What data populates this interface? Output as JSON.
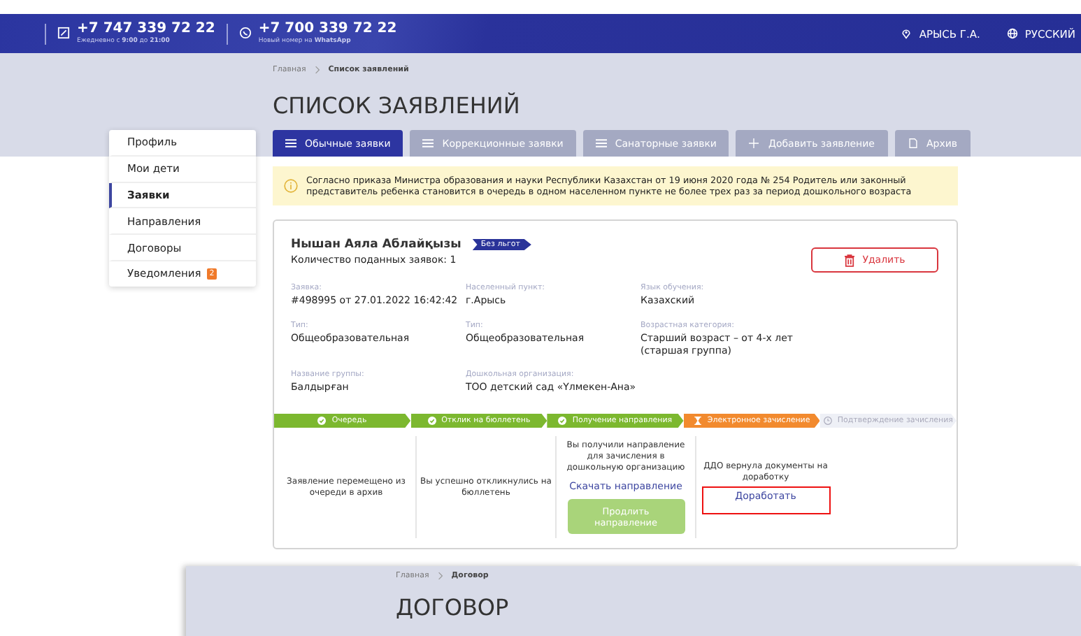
{
  "header": {
    "phone": "+7 747 339 72 22",
    "phone_hours": "Ежедневно с **9:00** до **21:00**",
    "whatsapp": "+7 700 339 72 22",
    "whatsapp_note": "Новый номер на **WhatsApp**",
    "location": "АРЫСЬ Г.А.",
    "language": "РУССКИЙ"
  },
  "breadcrumb": [
    "Главная",
    "Список заявлений"
  ],
  "title": "СПИСОК ЗАЯВЛЕНИЙ",
  "sidebar": [
    {
      "label": "Профиль",
      "selected": false
    },
    {
      "label": "Мои дети",
      "selected": false
    },
    {
      "label": "Заявки",
      "selected": true
    },
    {
      "label": "Направления",
      "selected": false
    },
    {
      "label": "Договоры",
      "selected": false
    },
    {
      "label": "Уведомления",
      "selected": false,
      "badge": "2"
    }
  ],
  "tabs": [
    {
      "label": "Обычные заявки",
      "selected": true,
      "kind": "list"
    },
    {
      "label": "Коррекционные заявки",
      "selected": false,
      "kind": "list"
    },
    {
      "label": "Санаторные заявки",
      "selected": false,
      "kind": "list"
    },
    {
      "label": "Добавить заявление",
      "selected": false,
      "kind": "add"
    },
    {
      "label": "Архив",
      "selected": false,
      "kind": "file"
    }
  ],
  "notice": "Согласно приказа Министра образования и науки Республики Казахстан от 19 июня 2020 года № 254 Родитель или законный представитель ребенка становится в очередь в одном населенном пункте не более трех раз за период дошкольного возраста",
  "application": {
    "name": "Нышан Аяла Аблайқызы",
    "tag": "Без льгот",
    "count": "Количество поданных заявок: 1",
    "delete": "Удалить",
    "fields": [
      {
        "label": "Заявка:",
        "value": "#498995 от 27.01.2022 16:42:42"
      },
      {
        "label": "Населенный пункт:",
        "value": "г.Арысь"
      },
      {
        "label": "Язык обучения:",
        "value": "Казахский"
      },
      {
        "label": "Тип:",
        "value": "Общеобразовательная"
      },
      {
        "label": "Тип:",
        "value": "Общеобразовательная"
      },
      {
        "label": "Возрастная категория:",
        "value": "Старший возраст – от 4-х лет (старшая группа)"
      },
      {
        "label": "Название группы:",
        "value": "Балдырған"
      },
      {
        "label": "Дошкольная организация:",
        "value": "ТОО детский сад «Үлмекен-Ана»"
      }
    ],
    "steps": [
      {
        "label": "Очередь",
        "kind": "done"
      },
      {
        "label": "Отклик на бюллетень",
        "kind": "done"
      },
      {
        "label": "Получение направления",
        "kind": "done"
      },
      {
        "label": "Электронное зачисление",
        "kind": "current"
      },
      {
        "label": "Подтверждение зачисления",
        "kind": "pending"
      }
    ],
    "stages": [
      {
        "text": "Заявление перемещено из очереди в архив"
      },
      {
        "text": "Вы успешно откликнулись на бюллетень"
      },
      {
        "text": "Вы получили направление для зачисления в дошкольную организацию",
        "link": "Скачать направление",
        "highlighted": false,
        "button": "Продлить направление",
        "button_disabled": true
      },
      {
        "text": "ДДО вернула документы на доработку",
        "link": "Доработать",
        "highlighted": true
      }
    ]
  },
  "second_page": {
    "breadcrumb": [
      "Главная",
      "Договор"
    ],
    "title": "ДОГОВОР"
  }
}
